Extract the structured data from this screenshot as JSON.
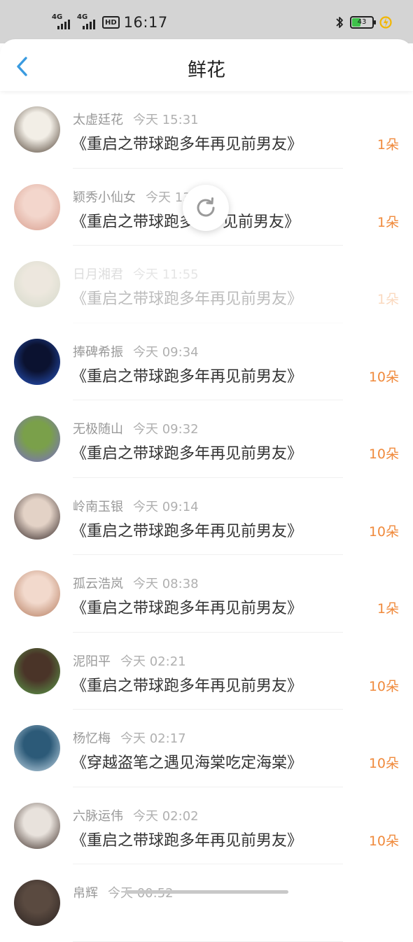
{
  "status_bar": {
    "net1": "4G",
    "net2": "4G",
    "hd": "HD",
    "time": "16:17",
    "battery": "43",
    "battery_level": 0.43
  },
  "header": {
    "title": "鲜花"
  },
  "colors": {
    "accent": "#f08a3c",
    "back": "#3a9be0"
  },
  "items": [
    {
      "name": "太虚廷花",
      "time": "今天 15:31",
      "book": "《重启之带球跑多年再见前男友》",
      "count": "1朵",
      "avatar_colors": [
        "#f2eee6",
        "#4a3b2e"
      ],
      "faded": false
    },
    {
      "name": "颖秀小仙女",
      "time": "今天 13",
      "book": "《重启之带球跑多",
      "book_tail": "见前男友》",
      "count": "1朵",
      "avatar_colors": [
        "#f3d6cc",
        "#d79c8c"
      ],
      "faded": false
    },
    {
      "name": "日月湘君",
      "time": "今天 11:55",
      "book": "《重启之带球跑多年再见前男友》",
      "count": "1朵",
      "avatar_colors": [
        "#c9b89a",
        "#7a8a5c"
      ],
      "faded": true
    },
    {
      "name": "捧碑希振",
      "time": "今天 09:34",
      "book": "《重启之带球跑多年再见前男友》",
      "count": "10朵",
      "avatar_colors": [
        "#0b1230",
        "#2a59c8"
      ],
      "faded": false
    },
    {
      "name": "无极随山",
      "time": "今天 09:32",
      "book": "《重启之带球跑多年再见前男友》",
      "count": "10朵",
      "avatar_colors": [
        "#7aa04a",
        "#7b6ad0"
      ],
      "faded": false
    },
    {
      "name": "岭南玉银",
      "time": "今天 09:14",
      "book": "《重启之带球跑多年再见前男友》",
      "count": "10朵",
      "avatar_colors": [
        "#e3d2c6",
        "#2c2020"
      ],
      "faded": false
    },
    {
      "name": "孤云浩岚",
      "time": "今天 08:38",
      "book": "《重启之带球跑多年再见前男友》",
      "count": "1朵",
      "avatar_colors": [
        "#f2d9cc",
        "#b2785a"
      ],
      "faded": false
    },
    {
      "name": "泥阳平",
      "time": "今天 02:21",
      "book": "《重启之带球跑多年再见前男友》",
      "count": "10朵",
      "avatar_colors": [
        "#4a3428",
        "#5ca04c"
      ],
      "faded": false
    },
    {
      "name": "杨忆梅",
      "time": "今天 02:17",
      "book": "《穿越盗笔之遇见海棠吃定海棠》",
      "count": "10朵",
      "avatar_colors": [
        "#2c5a78",
        "#c8dcea"
      ],
      "faded": false
    },
    {
      "name": "六脉运伟",
      "time": "今天 02:02",
      "book": "《重启之带球跑多年再见前男友》",
      "count": "10朵",
      "avatar_colors": [
        "#e8e2dc",
        "#3a2a24"
      ],
      "faded": false
    },
    {
      "name": "帛辉",
      "time": "今天 00:52",
      "book": "",
      "count": "",
      "avatar_colors": [
        "#5a4a40",
        "#2a2220"
      ],
      "faded": false
    }
  ]
}
